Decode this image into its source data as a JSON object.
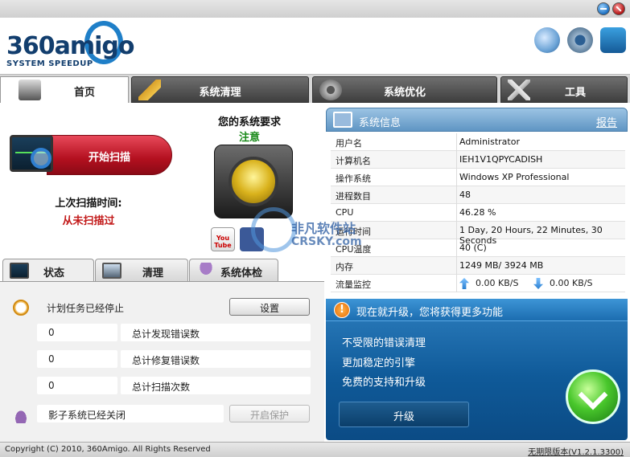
{
  "header": {
    "logo_text": "360amigo",
    "logo_sub": "SYSTEM SPEEDUP"
  },
  "tabs": [
    {
      "label": "首页",
      "icon": "home-icon"
    },
    {
      "label": "系统清理",
      "icon": "broom-icon"
    },
    {
      "label": "系统优化",
      "icon": "gears-icon"
    },
    {
      "label": "工具",
      "icon": "tools-icon"
    }
  ],
  "scan": {
    "button_label": "开始扫描",
    "last_scan_label": "上次扫描时间:",
    "last_scan_value": "从未扫描过"
  },
  "system_status": {
    "label": "您的系统要求",
    "value": "注意",
    "value_color": "#1a8a1a"
  },
  "social": {
    "youtube_label": "You Tube"
  },
  "subtabs": [
    {
      "label": "状态"
    },
    {
      "label": "清理"
    },
    {
      "label": "系统体检"
    }
  ],
  "status_panel": {
    "schedule_text": "计划任务已经停止",
    "settings_button": "设置",
    "rows": [
      {
        "count": "0",
        "label": "总计发现错误数"
      },
      {
        "count": "0",
        "label": "总计修复错误数"
      },
      {
        "count": "0",
        "label": "总计扫描次数"
      }
    ],
    "shadow_text": "影子系统已经关闭",
    "protect_button": "开启保护"
  },
  "system_info": {
    "title": "系统信息",
    "report_link": "报告",
    "rows": [
      {
        "key": "用户名",
        "value": "Administrator"
      },
      {
        "key": "计算机名",
        "value": "IEH1V1QPYCADISH"
      },
      {
        "key": "操作系统",
        "value": "Windows XP Professional"
      },
      {
        "key": "进程数目",
        "value": "48"
      },
      {
        "key": "CPU",
        "value": "46.28 %"
      },
      {
        "key": "运行时间",
        "value": "1 Day, 20 Hours, 22 Minutes, 30 Seconds"
      },
      {
        "key": "CPU温度",
        "value": "40 (C)"
      },
      {
        "key": "内存",
        "value": "1249 MB/ 3924 MB"
      }
    ],
    "network": {
      "key": "流量监控",
      "up": "0.00 KB/S",
      "down": "0.00 KB/S"
    }
  },
  "upgrade": {
    "banner": "现在就升级，您将获得更多功能",
    "features": [
      "不受限的错误清理",
      "更加稳定的引擎",
      "免费的支持和升级"
    ],
    "button": "升级"
  },
  "watermark": {
    "text": "非凡软件站",
    "sub": "CRSKY.com"
  },
  "footer": {
    "copyright": "Copyright (C) 2010, 360Amigo. All Rights Reserved",
    "version": "无期限版本(V1.2.1.3300)"
  }
}
